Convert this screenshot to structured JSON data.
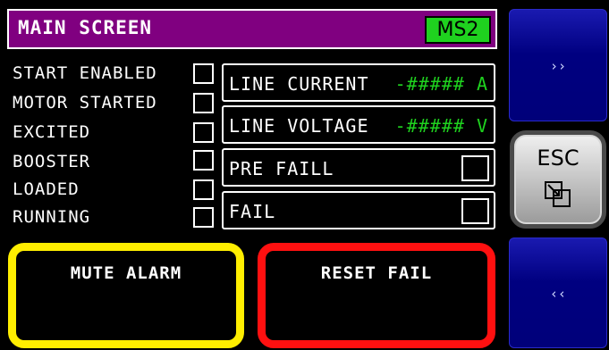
{
  "header": {
    "title": "MAIN SCREEN",
    "screen_id": "MS2",
    "bar_color": "#800080",
    "badge_color": "#1fd21f"
  },
  "status": [
    {
      "label": "START ENABLED"
    },
    {
      "label": "MOTOR STARTED"
    },
    {
      "label": "EXCITED"
    },
    {
      "label": "BOOSTER"
    },
    {
      "label": "LOADED"
    },
    {
      "label": "RUNNING"
    }
  ],
  "readouts": {
    "line_current": {
      "label": "LINE CURRENT",
      "value": "-##### A"
    },
    "line_voltage": {
      "label": "LINE VOLTAGE",
      "value": "-##### V"
    },
    "pre_fail": {
      "label": "PRE FAILL"
    },
    "fail": {
      "label": "FAIL"
    }
  },
  "nav": {
    "next_label": "››",
    "prev_label": "‹‹",
    "esc_label": "ESC",
    "esc_icon": "window-restore-icon",
    "nav_color": "#000080"
  },
  "buttons": {
    "mute_alarm": "MUTE ALARM",
    "reset_fail": "RESET FAIL",
    "mute_color": "#ffee00",
    "reset_color": "#ff1010"
  }
}
